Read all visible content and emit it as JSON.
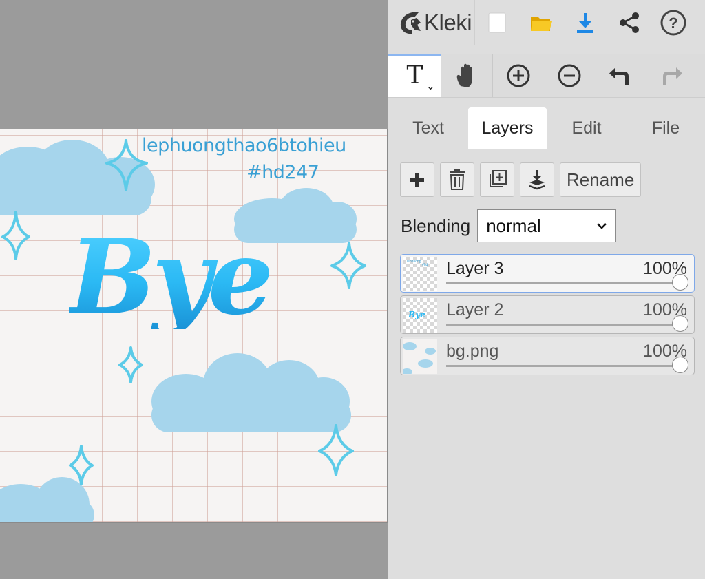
{
  "app": {
    "name": "Kleki"
  },
  "artwork": {
    "caption_line1": "lephuongthao6btohieu",
    "caption_line2": "#hd247",
    "main_text": "Bye"
  },
  "tabs": [
    {
      "label": "Text",
      "active": false
    },
    {
      "label": "Layers",
      "active": true
    },
    {
      "label": "Edit",
      "active": false
    },
    {
      "label": "File",
      "active": false
    }
  ],
  "layer_actions": {
    "rename_label": "Rename"
  },
  "blending": {
    "label": "Blending",
    "value": "normal"
  },
  "layers": [
    {
      "name": "Layer 3",
      "opacity": "100%",
      "selected": true
    },
    {
      "name": "Layer 2",
      "opacity": "100%",
      "selected": false
    },
    {
      "name": "bg.png",
      "opacity": "100%",
      "selected": false
    }
  ],
  "icons": {
    "new": "new-image-icon",
    "open": "open-folder-icon",
    "save": "download-icon",
    "share": "share-icon",
    "help": "help-icon",
    "hand": "hand-icon",
    "zoom_in": "zoom-in-icon",
    "zoom_out": "zoom-out-icon",
    "undo": "undo-icon",
    "redo": "redo-icon"
  },
  "colors": {
    "accent": "#1e88e5",
    "folder": "#f5c518",
    "sky_blue": "#2bb9f4",
    "cloud": "#a6d5ec"
  }
}
